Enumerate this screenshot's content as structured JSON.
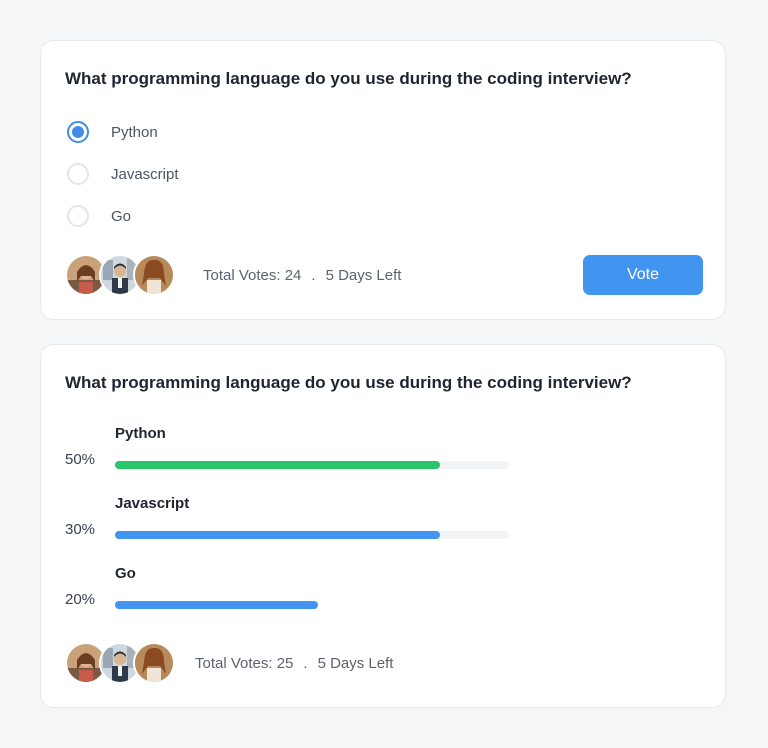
{
  "poll_vote": {
    "question": "What programming language do you use during the coding interview?",
    "options": [
      {
        "label": "Python",
        "selected": true
      },
      {
        "label": "Javascript",
        "selected": false
      },
      {
        "label": "Go",
        "selected": false
      }
    ],
    "total_votes": "Total Votes: 24",
    "separator": ".",
    "days_left": "5 Days Left",
    "vote_label": "Vote"
  },
  "poll_results": {
    "question": "What programming language do you use during the coding interview?",
    "results": [
      {
        "label": "Python",
        "percent_text": "50%",
        "bar_fill_fraction": 0.825,
        "color": "#2cc46a"
      },
      {
        "label": "Javascript",
        "percent_text": "30%",
        "bar_fill_fraction": 0.825,
        "color": "#4194f0"
      },
      {
        "label": "Go",
        "percent_text": "20%",
        "bar_fill_fraction": 0.515,
        "color": "#4194f0"
      }
    ],
    "total_votes": "Total Votes: 25",
    "separator": ".",
    "days_left": "5 Days Left"
  },
  "colors": {
    "accent": "#4194f0",
    "success": "#2cc46a",
    "radio_selected": "#3f8de6"
  }
}
